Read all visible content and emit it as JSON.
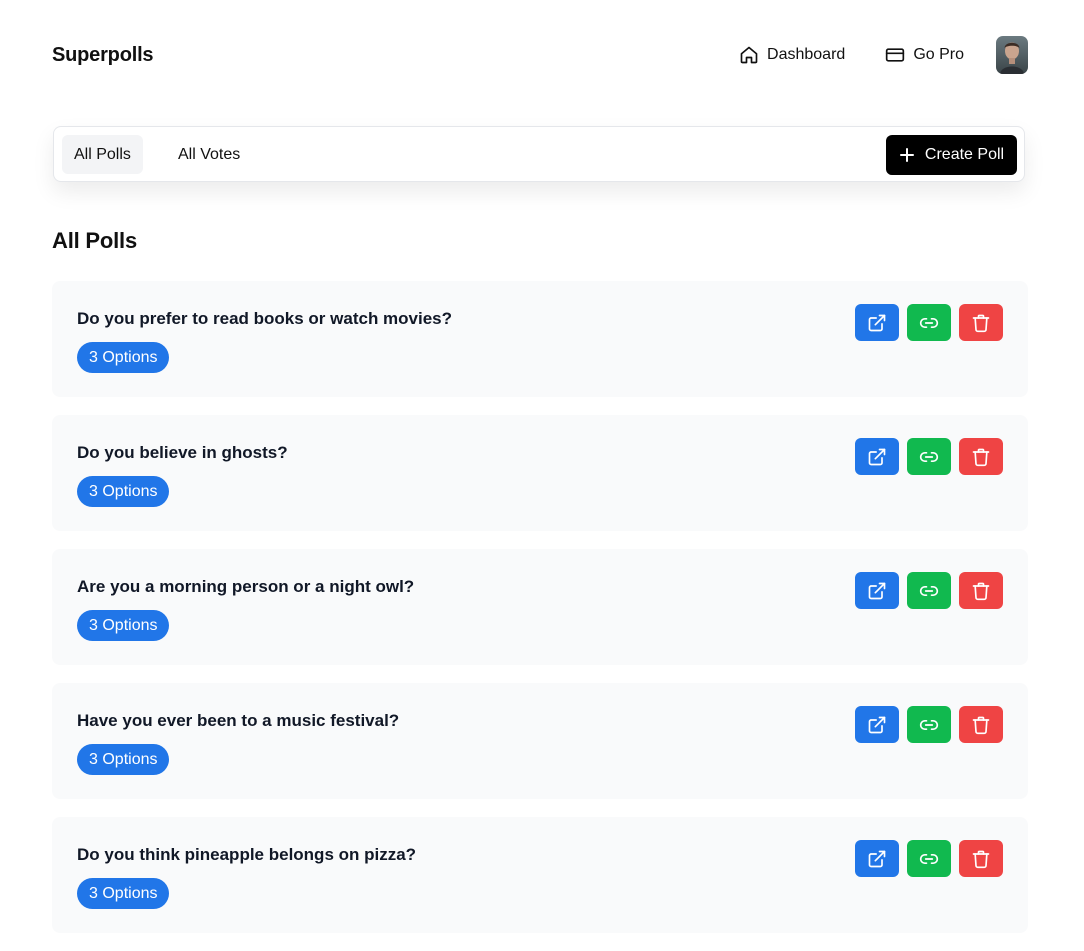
{
  "header": {
    "brand": "Superpolls",
    "nav": {
      "dashboard_label": "Dashboard",
      "gopro_label": "Go Pro"
    }
  },
  "toolbar": {
    "tabs": [
      {
        "label": "All Polls",
        "active": true
      },
      {
        "label": "All Votes",
        "active": false
      }
    ],
    "create_label": "Create Poll"
  },
  "main": {
    "title": "All Polls",
    "polls": [
      {
        "question": "Do you prefer to read books or watch movies?",
        "badge": "3 Options"
      },
      {
        "question": "Do you believe in ghosts?",
        "badge": "3 Options"
      },
      {
        "question": "Are you a morning person or a night owl?",
        "badge": "3 Options"
      },
      {
        "question": "Have you ever been to a music festival?",
        "badge": "3 Options"
      },
      {
        "question": "Do you think pineapple belongs on pizza?",
        "badge": "3 Options"
      }
    ]
  },
  "icons": {
    "dashboard": "home-icon",
    "gopro": "credit-card-icon",
    "create": "plus-icon",
    "open": "external-link-icon",
    "copy": "link-icon",
    "delete": "trash-icon"
  },
  "colors": {
    "primary": "#2176e8",
    "success": "#11b94f",
    "danger": "#ef4444",
    "dark": "#000000",
    "card_bg": "#f9fafb"
  }
}
